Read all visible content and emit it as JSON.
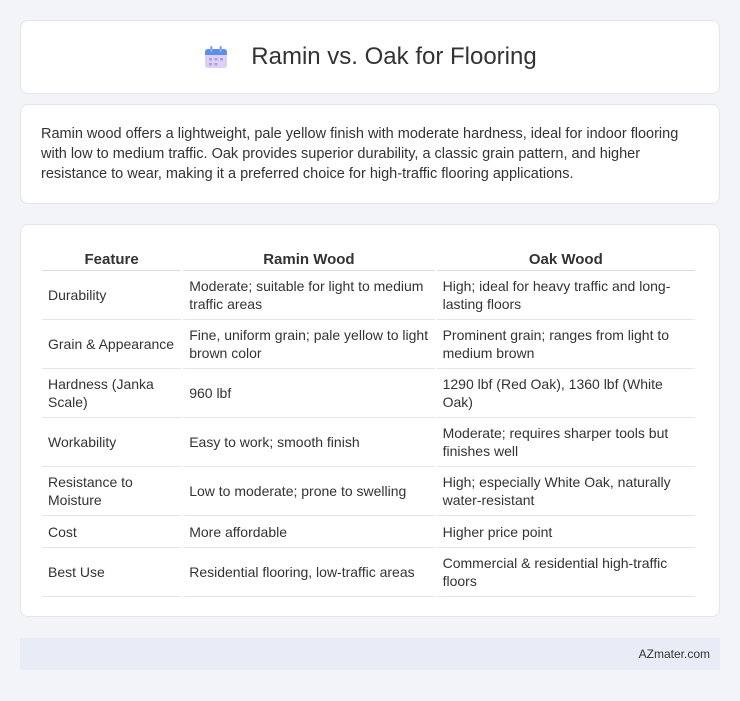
{
  "header": {
    "title": "Ramin vs. Oak for Flooring",
    "icon": "calendar-icon"
  },
  "intro": {
    "text": "Ramin wood offers a lightweight, pale yellow finish with moderate hardness, ideal for indoor flooring with low to medium traffic. Oak provides superior durability, a classic grain pattern, and higher resistance to wear, making it a preferred choice for high-traffic flooring applications."
  },
  "table": {
    "headers": [
      "Feature",
      "Ramin Wood",
      "Oak Wood"
    ],
    "rows": [
      [
        "Durability",
        "Moderate; suitable for light to medium traffic areas",
        "High; ideal for heavy traffic and long-lasting floors"
      ],
      [
        "Grain & Appearance",
        "Fine, uniform grain; pale yellow to light brown color",
        "Prominent grain; ranges from light to medium brown"
      ],
      [
        "Hardness (Janka Scale)",
        "960 lbf",
        "1290 lbf (Red Oak), 1360 lbf (White Oak)"
      ],
      [
        "Workability",
        "Easy to work; smooth finish",
        "Moderate; requires sharper tools but finishes well"
      ],
      [
        "Resistance to Moisture",
        "Low to moderate; prone to swelling",
        "High; especially White Oak, naturally water-resistant"
      ],
      [
        "Cost",
        "More affordable",
        "Higher price point"
      ],
      [
        "Best Use",
        "Residential flooring, low-traffic areas",
        "Commercial & residential high-traffic floors"
      ]
    ]
  },
  "footer": {
    "brand": "AZmater.com"
  },
  "colors": {
    "background": "#f3f4f8",
    "card": "#ffffff",
    "footer": "#e9ecf6",
    "icon_top": "#5a8ee8",
    "icon_body": "#cdbbf0"
  }
}
